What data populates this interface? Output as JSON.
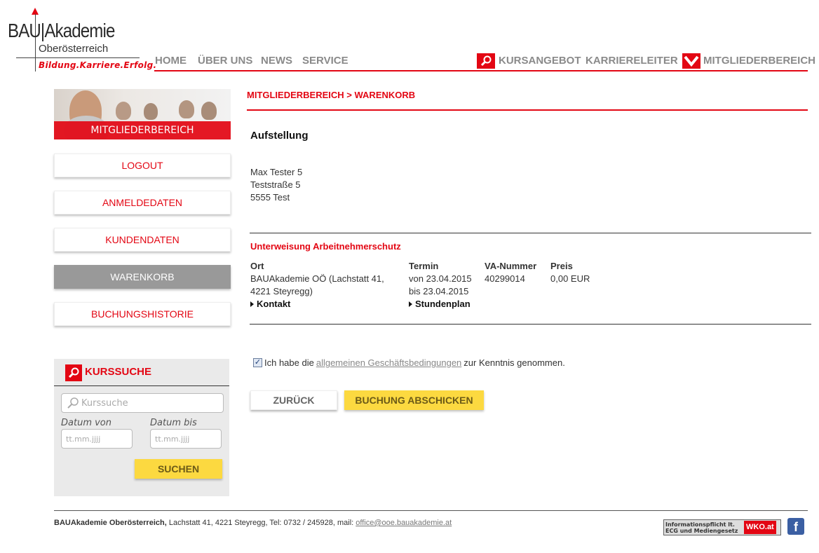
{
  "logo": {
    "brand": "BAU|Akademie",
    "region": "Oberösterreich",
    "tagline": "Bildung.Karriere.Erfolg."
  },
  "nav": {
    "left": [
      "HOME",
      "ÜBER UNS",
      "NEWS",
      "SERVICE"
    ],
    "kursangebot": "KURSANGEBOT",
    "karriereleiter": "KARRIERELEITER",
    "mitgliederbereich": "MITGLIEDERBEREICH"
  },
  "sidebar": {
    "banner_label": "MITGLIEDERBEREICH",
    "items": [
      {
        "label": "LOGOUT",
        "active": false
      },
      {
        "label": "ANMELDEDATEN",
        "active": false
      },
      {
        "label": "KUNDENDATEN",
        "active": false
      },
      {
        "label": "WARENKORB",
        "active": true
      },
      {
        "label": "BUCHUNGSHISTORIE",
        "active": false
      }
    ]
  },
  "search": {
    "title": "KURSSUCHE",
    "placeholder": "Kurssuche",
    "date_from_label": "Datum von",
    "date_to_label": "Datum bis",
    "date_placeholder": "tt.mm.jjjj",
    "submit_label": "SUCHEN"
  },
  "main": {
    "breadcrumb": "MITGLIEDERBEREICH > WARENKORB",
    "heading": "Aufstellung",
    "address": [
      "Max Tester 5",
      "Teststraße 5",
      "5555 Test"
    ],
    "course": {
      "title": "Unterweisung Arbeitnehmerschutz",
      "headers": {
        "ort": "Ort",
        "termin": "Termin",
        "va": "VA-Nummer",
        "preis": "Preis"
      },
      "ort": [
        "BAUAkademie OÖ (Lachstatt 41,",
        "4221 Steyregg)"
      ],
      "termin": [
        "von 23.04.2015",
        "bis 23.04.2015"
      ],
      "va_nummer": "40299014",
      "preis": "0,00 EUR",
      "kontakt_label": "Kontakt",
      "stundenplan_label": "Stundenplan"
    },
    "agb": {
      "checked": true,
      "before": "Ich habe die",
      "link": "allgemeinen Geschäftsbedingungen",
      "after": "zur Kenntnis genommen."
    },
    "back_label": "ZURÜCK",
    "submit_label": "BUCHUNG ABSCHICKEN"
  },
  "footer": {
    "company": "BAUAkademie Oberösterreich,",
    "address": "Lachstatt 41, 4221 Steyregg, Tel: 0732 / 245928, mail:",
    "email": "office@ooe.bauakademie.at",
    "wko_text_1": "Informationspflicht lt.",
    "wko_text_2": "ECG und Mediengesetz",
    "wko_brand": "WKO.at",
    "facebook": "f"
  },
  "colors": {
    "accent": "#e30613",
    "yellow": "#fcd940",
    "active_grey": "#999999"
  }
}
